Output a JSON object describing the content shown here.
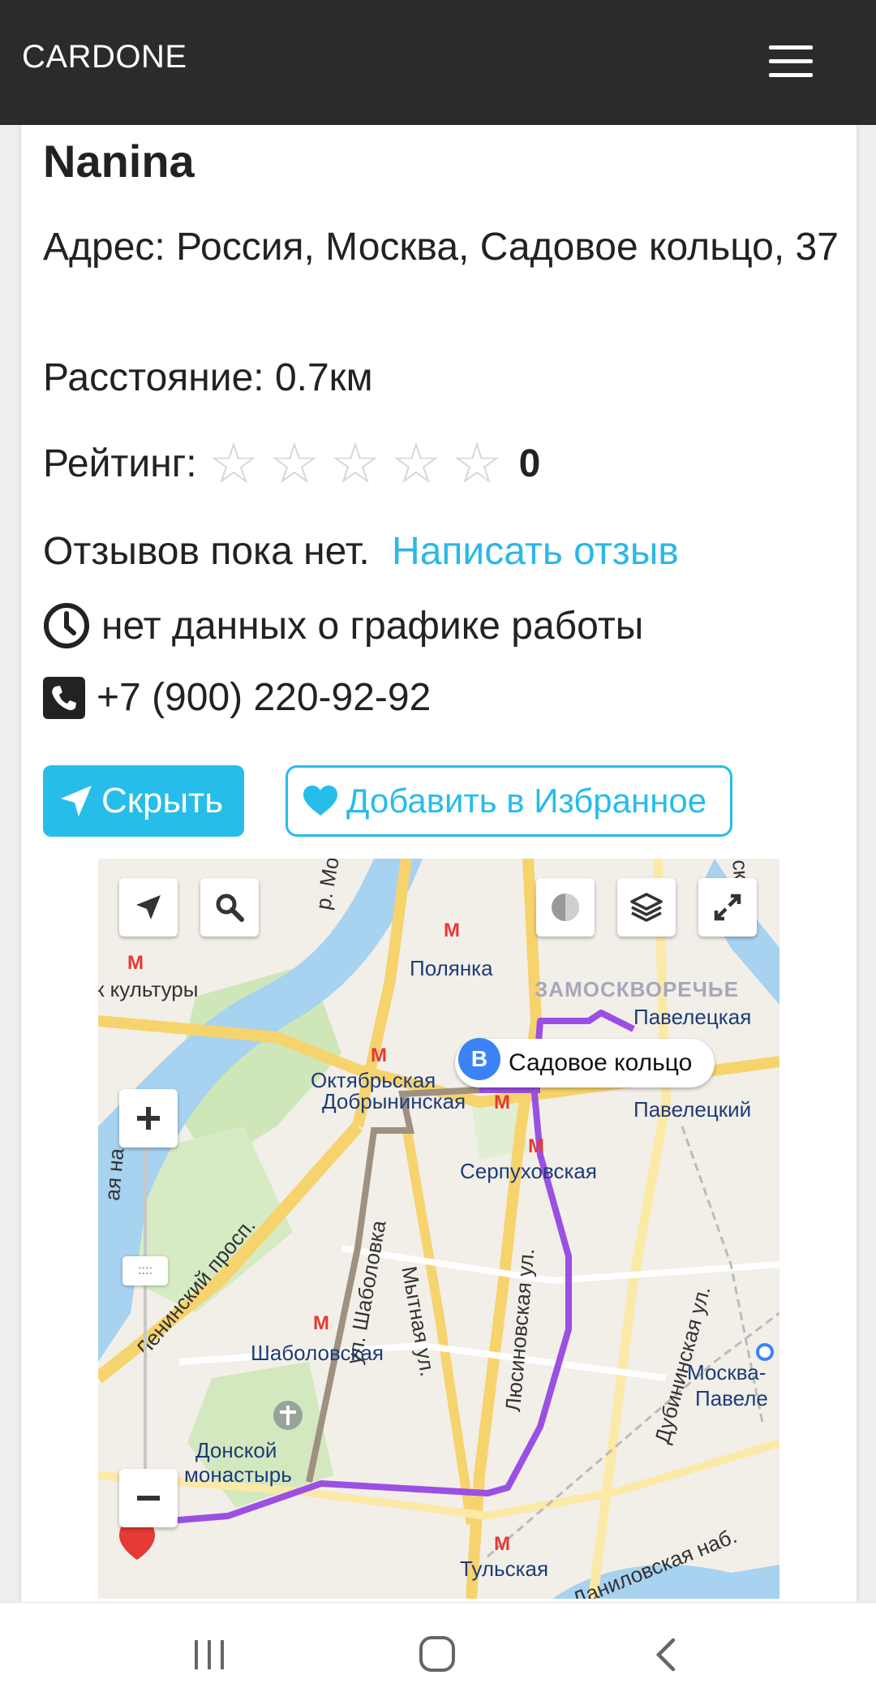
{
  "header": {
    "brand": "CARDONE",
    "menu_icon": "hamburger-icon"
  },
  "place": {
    "name": "Nanina",
    "address": "Адрес: Россия, Москва, Садовое кольцо, 37",
    "distance": "Расстояние: 0.7км",
    "rating_label": "Рейтинг:",
    "rating_value": "0",
    "rating_stars_filled": 0,
    "rating_stars_total": 5,
    "no_reviews": "Отзывов пока нет.",
    "write_review": "Написать отзыв",
    "hours": "нет данных о графике работы",
    "phone": "+7 (900) 220-92-92"
  },
  "actions": {
    "hide_label": "Скрыть",
    "favorite_label": "Добавить в Избранное"
  },
  "map": {
    "destination_marker": "B",
    "destination_label": "Садовое кольцо",
    "labels": {
      "park": "к культуры",
      "polyanka": "Полянка",
      "zamoskvorechye": "ЗАМОСКВОРЕЧЬЕ",
      "paveletskaya": "Павелецкая",
      "oktyabrskaya": "Октябрьская",
      "dobryninskaya": "Добрынинская",
      "paveletsky": "Павелецкий",
      "serpukhovskaya": "Серпуховская",
      "shabolovskaya": "Шаболовская",
      "donskoy1": "Донской",
      "donskoy2": "монастырь",
      "tulskaya": "Тульская",
      "moskva1": "Москва-",
      "moskva2": "Павеле",
      "leninsky": "Ленинский просп.",
      "shabolovka": "ул. Шаболовка",
      "mytnaya": "Мытная ул.",
      "lyusinovskaya": "Люсиновская ул.",
      "dubininskaya": "Дубининская ул.",
      "danilovskaya": "Даниловская наб.",
      "nab": "ая на",
      "r_mo": "р. Мо",
      "skaya": "ская н"
    },
    "route_color": "#9b4fe3",
    "controls": [
      "location-arrow-icon",
      "search-icon",
      "traffic-icon",
      "layers-icon",
      "fullscreen-icon",
      "zoom-in-icon",
      "zoom-out-icon"
    ]
  },
  "colors": {
    "accent": "#26bdea",
    "header_bg": "#2b2b2b"
  }
}
